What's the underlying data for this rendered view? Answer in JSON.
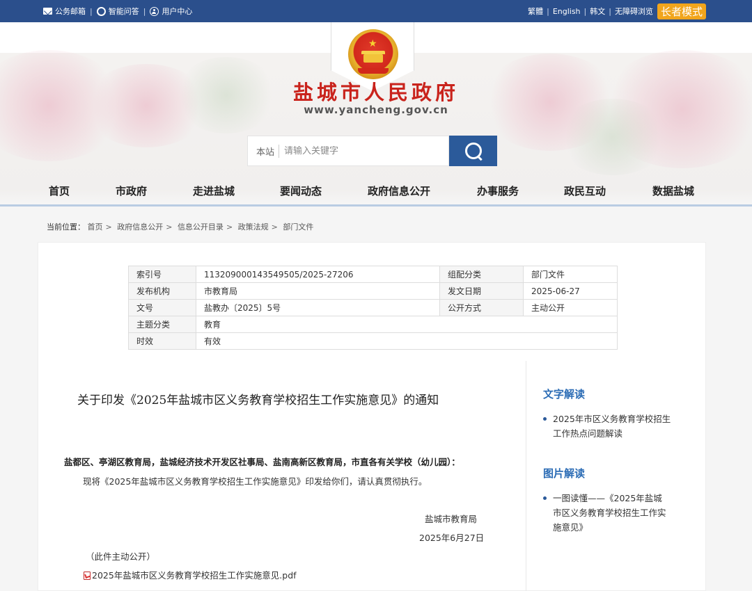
{
  "topbar": {
    "links": [
      {
        "label": "公务邮箱",
        "icon": "mail-icon"
      },
      {
        "label": "智能问答",
        "icon": "chat-icon"
      },
      {
        "label": "用户中心",
        "icon": "user-icon"
      }
    ],
    "right_links": [
      "繁體",
      "English",
      "韩文",
      "无障碍浏览"
    ],
    "elder_mode": "长者模式"
  },
  "header": {
    "title": "盐城市人民政府",
    "url": "www.yancheng.gov.cn"
  },
  "search": {
    "scope": "本站",
    "placeholder": "请输入关键字"
  },
  "nav": [
    "首页",
    "市政府",
    "走进盐城",
    "要闻动态",
    "政府信息公开",
    "办事服务",
    "政民互动",
    "数据盐城"
  ],
  "breadcrumb": {
    "label": "当前位置：",
    "items": [
      "首页",
      "政府信息公开",
      "信息公开目录",
      "政策法规",
      "部门文件"
    ]
  },
  "meta": {
    "index_label": "索引号",
    "index_value": "113209000143549505/2025-27206",
    "group_label": "组配分类",
    "group_value": "部门文件",
    "issuer_label": "发布机构",
    "issuer_value": "市教育局",
    "date_label": "发文日期",
    "date_value": "2025-06-27",
    "docno_label": "文号",
    "docno_value": "盐教办〔2025〕5号",
    "open_label": "公开方式",
    "open_value": "主动公开",
    "topic_label": "主题分类",
    "topic_value": "教育",
    "valid_label": "时效",
    "valid_value": "有效"
  },
  "document": {
    "title": "关于印发《2025年盐城市区义务教育学校招生工作实施意见》的通知",
    "recipients": "盐都区、亭湖区教育局，盐城经济技术开发区社事局、盐南高新区教育局，市直各有关学校（幼儿园）：",
    "body": "现将《2025年盐城市区义务教育学校招生工作实施意见》印发给你们，请认真贯彻执行。",
    "sign_org": "盐城市教育局",
    "sign_date": "2025年6月27日",
    "public_note": "（此件主动公开）",
    "attachment": "2025年盐城市区义务教育学校招生工作实施意见.pdf"
  },
  "sidebar": {
    "text_reading_title": "文字解读",
    "text_reading_item": "2025年市区义务教育学校招生工作热点问题解读",
    "image_reading_title": "图片解读",
    "image_reading_item": "一图读懂——《2025年盐城市区义务教育学校招生工作实施意见》"
  },
  "colors": {
    "topbar": "#2b4f8c",
    "accent_blue": "#2b6cb5",
    "title_red": "#c9231c",
    "elder_orange": "#f1a51c"
  }
}
